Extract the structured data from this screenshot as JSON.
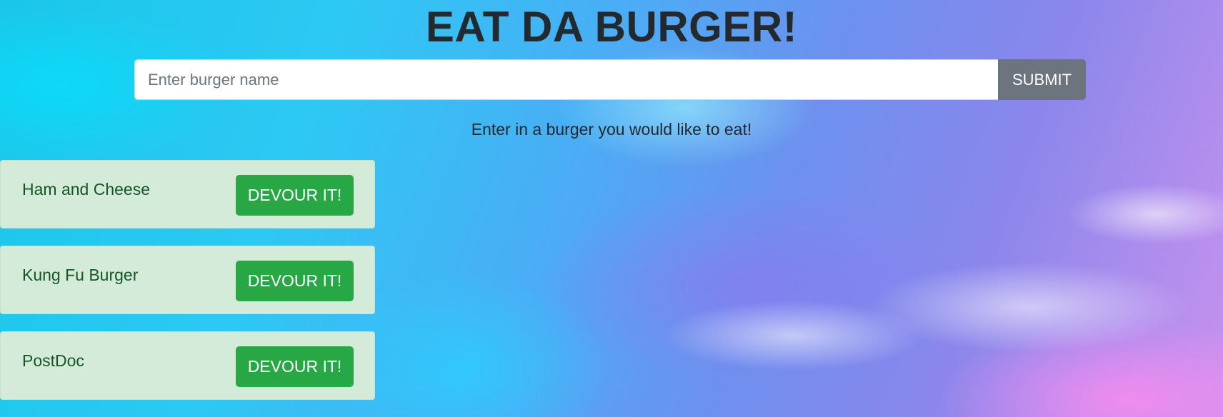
{
  "header": {
    "title": "EAT DA BURGER!"
  },
  "form": {
    "input_placeholder": "Enter burger name",
    "input_value": "",
    "submit_label": "SUBMIT"
  },
  "prompt_text": "Enter in a burger you would like to eat!",
  "burgers": [
    {
      "name": "Ham and Cheese",
      "button_label": "DEVOUR IT!"
    },
    {
      "name": "Kung Fu Burger",
      "button_label": "DEVOUR IT!"
    },
    {
      "name": "PostDoc",
      "button_label": "DEVOUR IT!"
    }
  ],
  "colors": {
    "card_background": "#d4ebd9",
    "card_text": "#155724",
    "devour_button": "#28a745",
    "submit_button": "#6c757d",
    "title_text": "#24292e"
  }
}
